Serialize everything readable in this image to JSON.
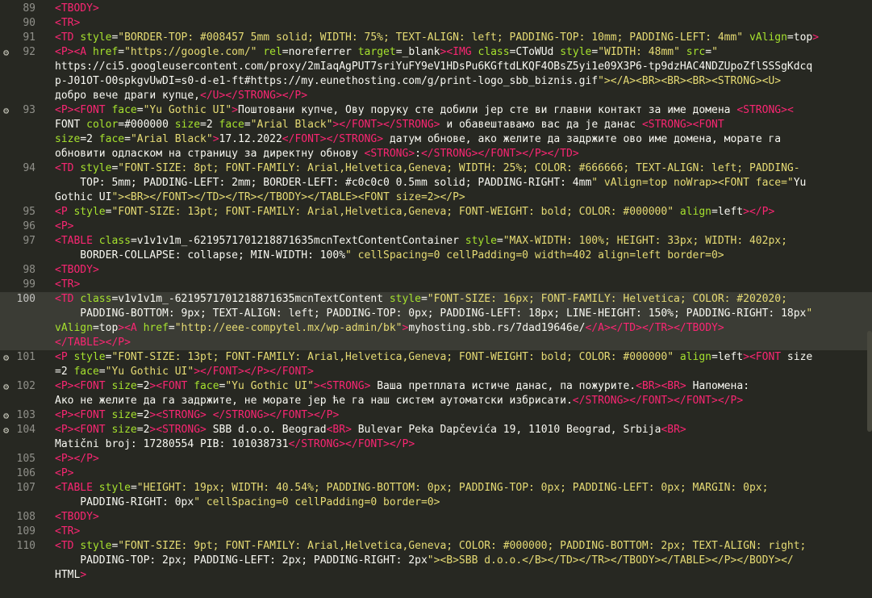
{
  "editor": {
    "lines": [
      {
        "num": "89",
        "text": "<TBODY>"
      },
      {
        "num": "90",
        "text": "<TR>"
      },
      {
        "num": "91",
        "text": "<TD style=\"BORDER-TOP: #008457 5mm solid; WIDTH: 75%; TEXT-ALIGN: left; PADDING-TOP: 10mm; PADDING-LEFT: 4mm\" vAlign=top>"
      },
      {
        "num": "92",
        "text": "<P><A href=\"https://google.com/\" rel=noreferrer target=_blank><IMG class=CToWUd style=\"WIDTH: 48mm\" src=\"",
        "marker": true
      },
      {
        "num": "",
        "text": "https://ci5.googleusercontent.com/proxy/2mIaqAgPUT7sriYuFY9eV1HDsPu6KGftdLKQF4OBsZ5yi1e09X3P6-tp9dzHAC4NDZUpoZflSSSgKdcq"
      },
      {
        "num": "",
        "text": "p-J01OT-O0spkgvUwDI=s0-d-e1-ft#https://my.eunethosting.com/g/print-logo_sbb_biznis.gif\"></A><BR><BR><BR><STRONG><U>"
      },
      {
        "num": "",
        "text": "добро вече драги купце,</U></STRONG></P>"
      },
      {
        "num": "93",
        "text": "<P><FONT face=\"Yu Gothic UI\">Поштовани купче, Ову поруку сте добили јер сте ви главни контакт за име домена <STRONG><",
        "marker": true
      },
      {
        "num": "",
        "text": "FONT color=#000000 size=2 face=\"Arial Black\"></FONT></STRONG> и обавештавамо вас да је данас <STRONG><FONT"
      },
      {
        "num": "",
        "text": "size=2 face=\"Arial Black\">17.12.2022</FONT></STRONG> датум обнове, ако желите да задржите ово име домена, морате га"
      },
      {
        "num": "",
        "text": "обновити одласком на страницу за директну обнову <STRONG>:</STRONG></FONT></P></TD>"
      },
      {
        "num": "94",
        "text": "<TD style=\"FONT-SIZE: 8pt; FONT-FAMILY: Arial,Helvetica,Geneva; WIDTH: 25%; COLOR: #666666; TEXT-ALIGN: left; PADDING-"
      },
      {
        "num": "",
        "text": "    TOP: 5mm; PADDING-LEFT: 2mm; BORDER-LEFT: #c0c0c0 0.5mm solid; PADDING-RIGHT: 4mm\" vAlign=top noWrap><FONT face=\"Yu"
      },
      {
        "num": "",
        "text": "Gothic UI\"><BR></FONT></TD></TR></TBODY></TABLE><FONT size=2></P>"
      },
      {
        "num": "95",
        "text": "<P style=\"FONT-SIZE: 13pt; FONT-FAMILY: Arial,Helvetica,Geneva; FONT-WEIGHT: bold; COLOR: #000000\" align=left></P>"
      },
      {
        "num": "96",
        "text": "<P>"
      },
      {
        "num": "97",
        "text": "<TABLE class=v1v1v1m_-6219571701218871635mcnTextContentContainer style=\"MAX-WIDTH: 100%; HEIGHT: 33px; WIDTH: 402px;"
      },
      {
        "num": "",
        "text": "    BORDER-COLLAPSE: collapse; MIN-WIDTH: 100%\" cellSpacing=0 cellPadding=0 width=402 align=left border=0>"
      },
      {
        "num": "98",
        "text": "<TBODY>"
      },
      {
        "num": "99",
        "text": "<TR>"
      },
      {
        "num": "100",
        "text": "<TD class=v1v1v1m_-6219571701218871635mcnTextContent style=\"FONT-SIZE: 16px; FONT-FAMILY: Helvetica; COLOR: #202020;",
        "highlight": true
      },
      {
        "num": "",
        "text": "    PADDING-BOTTOM: 9px; TEXT-ALIGN: left; PADDING-TOP: 0px; PADDING-LEFT: 18px; LINE-HEIGHT: 150%; PADDING-RIGHT: 18px\"",
        "highlight": true
      },
      {
        "num": "",
        "text": "vAlign=top><A href=\"http://eee-compytel.mx/wp-admin/bk\">myhosting.sbb.rs/7dad19646e/</A></TD></TR></TBODY>",
        "highlight": true
      },
      {
        "num": "",
        "text": "</TABLE></P>",
        "highlight": true
      },
      {
        "num": "101",
        "text": "<P style=\"FONT-SIZE: 13pt; FONT-FAMILY: Arial,Helvetica,Geneva; FONT-WEIGHT: bold; COLOR: #000000\" align=left><FONT size",
        "marker": true
      },
      {
        "num": "",
        "text": "=2 face=\"Yu Gothic UI\"></FONT></P></FONT>"
      },
      {
        "num": "102",
        "text": "<P><FONT size=2><FONT face=\"Yu Gothic UI\"><STRONG> Ваша претплата истиче данас, па пожурите.<BR><BR> Напомена:",
        "marker": true
      },
      {
        "num": "",
        "text": "Ако не желите да га задржите, не морате јер ће га наш систем аутоматски избрисати.</STRONG></FONT></FONT></P>"
      },
      {
        "num": "103",
        "text": "<P><FONT size=2><STRONG> </STRONG></FONT></P>",
        "marker": true
      },
      {
        "num": "104",
        "text": "<P><FONT size=2><STRONG> SBB d.o.o. Beograd<BR> Bulevar Peka Dapčevića 19, 11010 Beograd, Srbija<BR>",
        "marker": true
      },
      {
        "num": "",
        "text": "Matični broj: 17280554 PIB: 101038731</STRONG></FONT></P>"
      },
      {
        "num": "105",
        "text": "<P></P>"
      },
      {
        "num": "106",
        "text": "<P>"
      },
      {
        "num": "107",
        "text": "<TABLE style=\"HEIGHT: 19px; WIDTH: 40.54%; PADDING-BOTTOM: 0px; PADDING-TOP: 0px; PADDING-LEFT: 0px; MARGIN: 0px;"
      },
      {
        "num": "",
        "text": "    PADDING-RIGHT: 0px\" cellSpacing=0 cellPadding=0 border=0>"
      },
      {
        "num": "108",
        "text": "<TBODY>"
      },
      {
        "num": "109",
        "text": "<TR>"
      },
      {
        "num": "110",
        "text": "<TD style=\"FONT-SIZE: 9pt; FONT-FAMILY: Arial,Helvetica,Geneva; COLOR: #000000; PADDING-BOTTOM: 2px; TEXT-ALIGN: right;"
      },
      {
        "num": "",
        "text": "    PADDING-TOP: 2px; PADDING-LEFT: 2px; PADDING-RIGHT: 2px\"><B>SBB d.o.o.</B></TD></TR></TBODY></TABLE></P></BODY></"
      },
      {
        "num": "",
        "text": "HTML>"
      }
    ]
  },
  "icons": {
    "line_marker": "gear-icon"
  },
  "colors": {
    "background": "#272822",
    "tag": "#f92672",
    "attr": "#a6e22e",
    "string": "#e6db74",
    "number": "#ae81ff"
  }
}
